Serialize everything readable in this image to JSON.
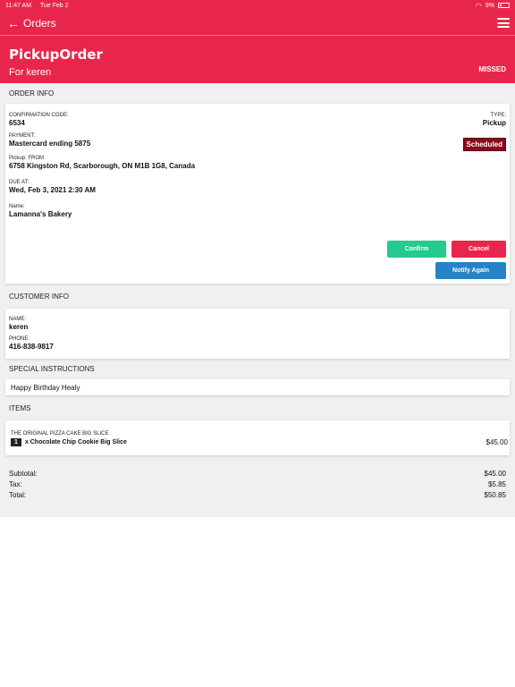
{
  "status_bar": {
    "time": "11:47 AM",
    "date": "Tue Feb 2",
    "battery": "9%"
  },
  "nav": {
    "back_label": "Orders"
  },
  "header": {
    "title": "PickupOrder",
    "subtitle": "For keren",
    "status": "MISSED"
  },
  "order_info": {
    "section_label": "ORDER INFO",
    "confirmation_label": "CONFIRMATION CODE:",
    "confirmation_code": "6534",
    "type_label": "TYPE:",
    "type_value": "Pickup",
    "payment_label": "PAYMENT:",
    "payment_value": "Mastercard ending 5875",
    "schedule_badge": "Scheduled",
    "pickup_label": "Pickup: FROM",
    "pickup_address": "6758 Kingston Rd, Scarborough, ON M1B 1G8, Canada",
    "due_label": "DUE AT:",
    "due_value": "Wed, Feb 3, 2021 2:30 AM",
    "name_label": "Name:",
    "name_value": "Lamanna's Bakery",
    "confirm_label": "Confirm",
    "cancel_label": "Cancel",
    "notify_label": "Notify Again"
  },
  "customer_info": {
    "section_label": "CUSTOMER INFO",
    "name_label": "NAME:",
    "name_value": "keren",
    "phone_label": "PHONE:",
    "phone_value": "416-838-9817"
  },
  "special_instructions": {
    "section_label": "SPECIAL INSTRUCTIONS",
    "text": "Happy Birthday Healy"
  },
  "items": {
    "section_label": "ITEMS",
    "list": [
      {
        "category": "THE ORIGINAL PIZZA CAKE BIG SLICE",
        "quantity": "1",
        "name": "x Chocolate Chip Cookie Big Slice",
        "price": "$45.00"
      }
    ]
  },
  "totals": {
    "subtotal_label": "Subtotal:",
    "subtotal_value": "$45.00",
    "tax_label": "Tax:",
    "tax_value": "$5.85",
    "total_label": "Total:",
    "total_value": "$50.85"
  },
  "colors": {
    "brand": "#e8264b",
    "confirm": "#26c98e",
    "notify": "#2584c9",
    "scheduled": "#8a0a1e"
  },
  "icons": {
    "back": "arrow-left-icon",
    "menu": "hamburger-menu-icon",
    "wifi": "wifi-icon",
    "battery": "battery-icon"
  }
}
